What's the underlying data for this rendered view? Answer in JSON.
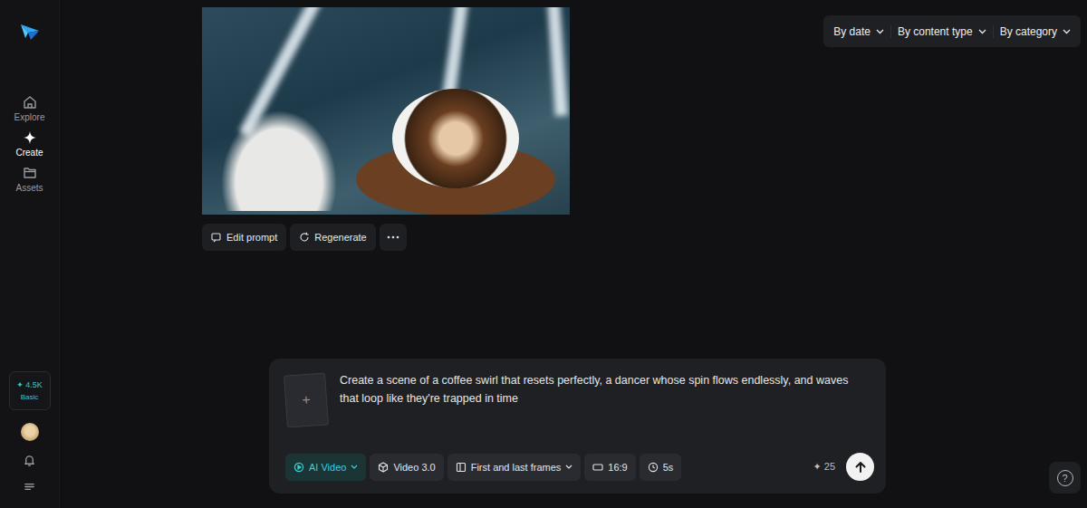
{
  "sidebar": {
    "items": [
      {
        "label": "Explore",
        "selected": false
      },
      {
        "label": "Create",
        "selected": true
      },
      {
        "label": "Assets",
        "selected": false
      }
    ],
    "credits": {
      "icon": "✦",
      "amount": "4.5K",
      "plan": "Basic"
    }
  },
  "filters": [
    {
      "label": "By date"
    },
    {
      "label": "By content type"
    },
    {
      "label": "By category"
    }
  ],
  "result": {
    "actions": [
      {
        "label": "Edit prompt"
      },
      {
        "label": "Regenerate"
      }
    ]
  },
  "prompt": {
    "upload_icon": "+",
    "text": "Create a scene of a coffee swirl that resets perfectly, a dancer whose spin flows endlessly, and waves that loop like they're trapped in time",
    "options": [
      {
        "label": "AI Video",
        "selected": true,
        "dropdown": true
      },
      {
        "label": "Video 3.0",
        "selected": false,
        "dropdown": false
      },
      {
        "label": "First and last frames",
        "selected": false,
        "dropdown": true
      },
      {
        "label": "16:9",
        "selected": false,
        "dropdown": false
      },
      {
        "label": "5s",
        "selected": false,
        "dropdown": false
      }
    ],
    "cost_icon": "✦",
    "cost": "25"
  },
  "help": {
    "icon": "?"
  }
}
